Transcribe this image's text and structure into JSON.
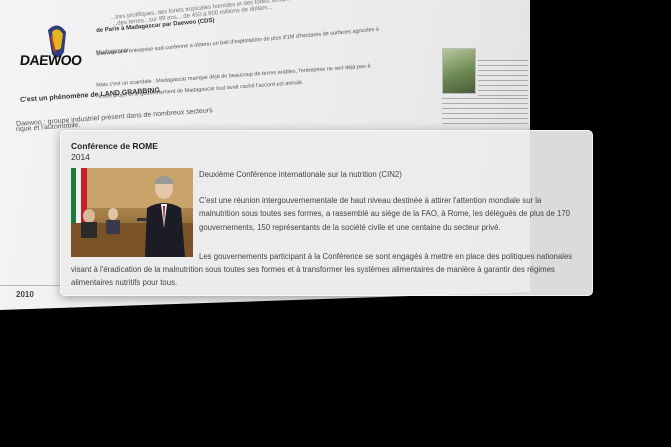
{
  "background_page": {
    "logo_text": "DAEWOO",
    "lines": [
      "...tres prolifiques, des forets tropicales humides et des forets xerophiles...",
      "...des terres...sur 99 ans,...de 450 à 800 millions de dollars...",
      "de Paris à Madagascar par Daewoo (CDS)",
      "Daewoo une entreprise sud-coréenne a obtenu un bail d'exploitation de plus d'1M d'hectares de surfaces agricoles à",
      "Madagascar.",
      "Mais c'est un scandale : Madagascar manque déjà de beaucoup de terres arables, l'entreprise ne sert déjà pas à",
      "à son projet et le gouvernement de Madagascar tout avait caché l'accord est annulé.",
      "C'est un phénomène de LAND GRABBING",
      "Daewoo : groupe industriel présent dans de nombreux secteurs",
      "rique et l'automobile."
    ],
    "timeline_year": "2010"
  },
  "card": {
    "title": "Conférence de ROME",
    "year": "2014",
    "subtitle": "Deuxième Conférence internationale sur la nutrition (CIN2)",
    "paragraph1": "C'est une réunion intergouvernementale de haut niveau destinée à attirer l'attention mondiale sur la malnutrition sous toutes ses formes, a rassemblé au siège de la FAO, à Rome, les délégués de plus de 170 gouvernements, 150 représentants de la société civile et une centaine du secteur privé.",
    "paragraph2_line1": "Les gouvernements participant à la Conférence se sont engagés à mettre en place des politiques nationales",
    "paragraph2_rest": "visant à l'éradication de la malnutrition sous toutes ses formes et à transformer les systèmes alimentaires de manière à garantir des régimes alimentaires nutritifs pour tous."
  }
}
